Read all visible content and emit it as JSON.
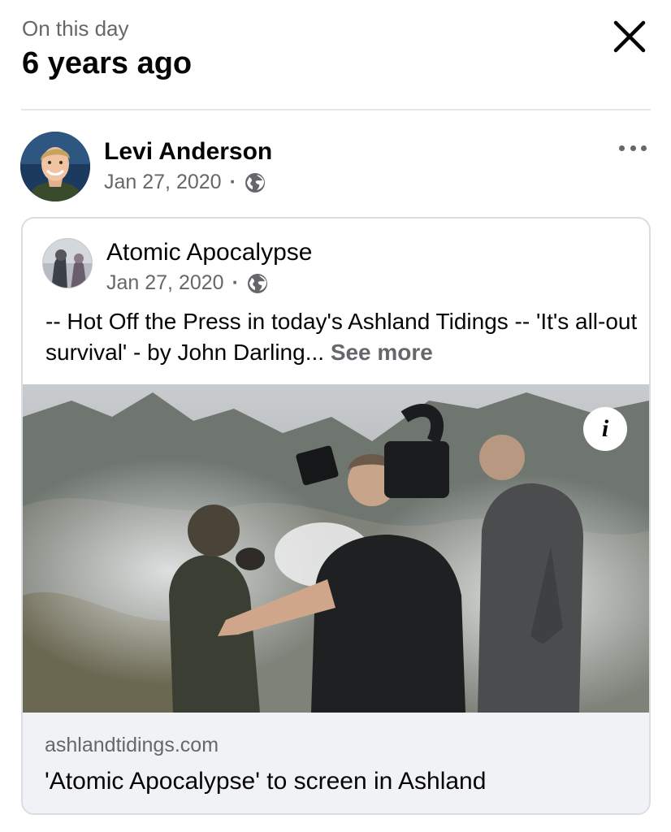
{
  "memory": {
    "subtitle": "On this day",
    "title": "6 years ago"
  },
  "post": {
    "author": "Levi Anderson",
    "date": "Jan 27, 2020",
    "separator": "·",
    "privacy_icon": "globe-icon"
  },
  "shared_post": {
    "page_name": "Atomic Apocalypse",
    "date": "Jan 27, 2020",
    "separator": "·",
    "privacy_icon": "globe-icon",
    "text": "-- Hot Off the Press in today's Ashland Tidings -- 'It's all-out survival' - by John Darling...",
    "see_more": "See more",
    "info_icon_glyph": "i"
  },
  "link_preview": {
    "domain": "ashlandtidings.com",
    "title": "'Atomic Apocalypse' to screen in Ashland"
  },
  "icons": {
    "close": "close-icon",
    "more": "more-options-icon",
    "info": "info-icon"
  },
  "colors": {
    "primary_text": "#050505",
    "secondary_text": "#65676b",
    "divider": "#e4e6eb",
    "link_preview_bg": "#f0f2f5"
  }
}
